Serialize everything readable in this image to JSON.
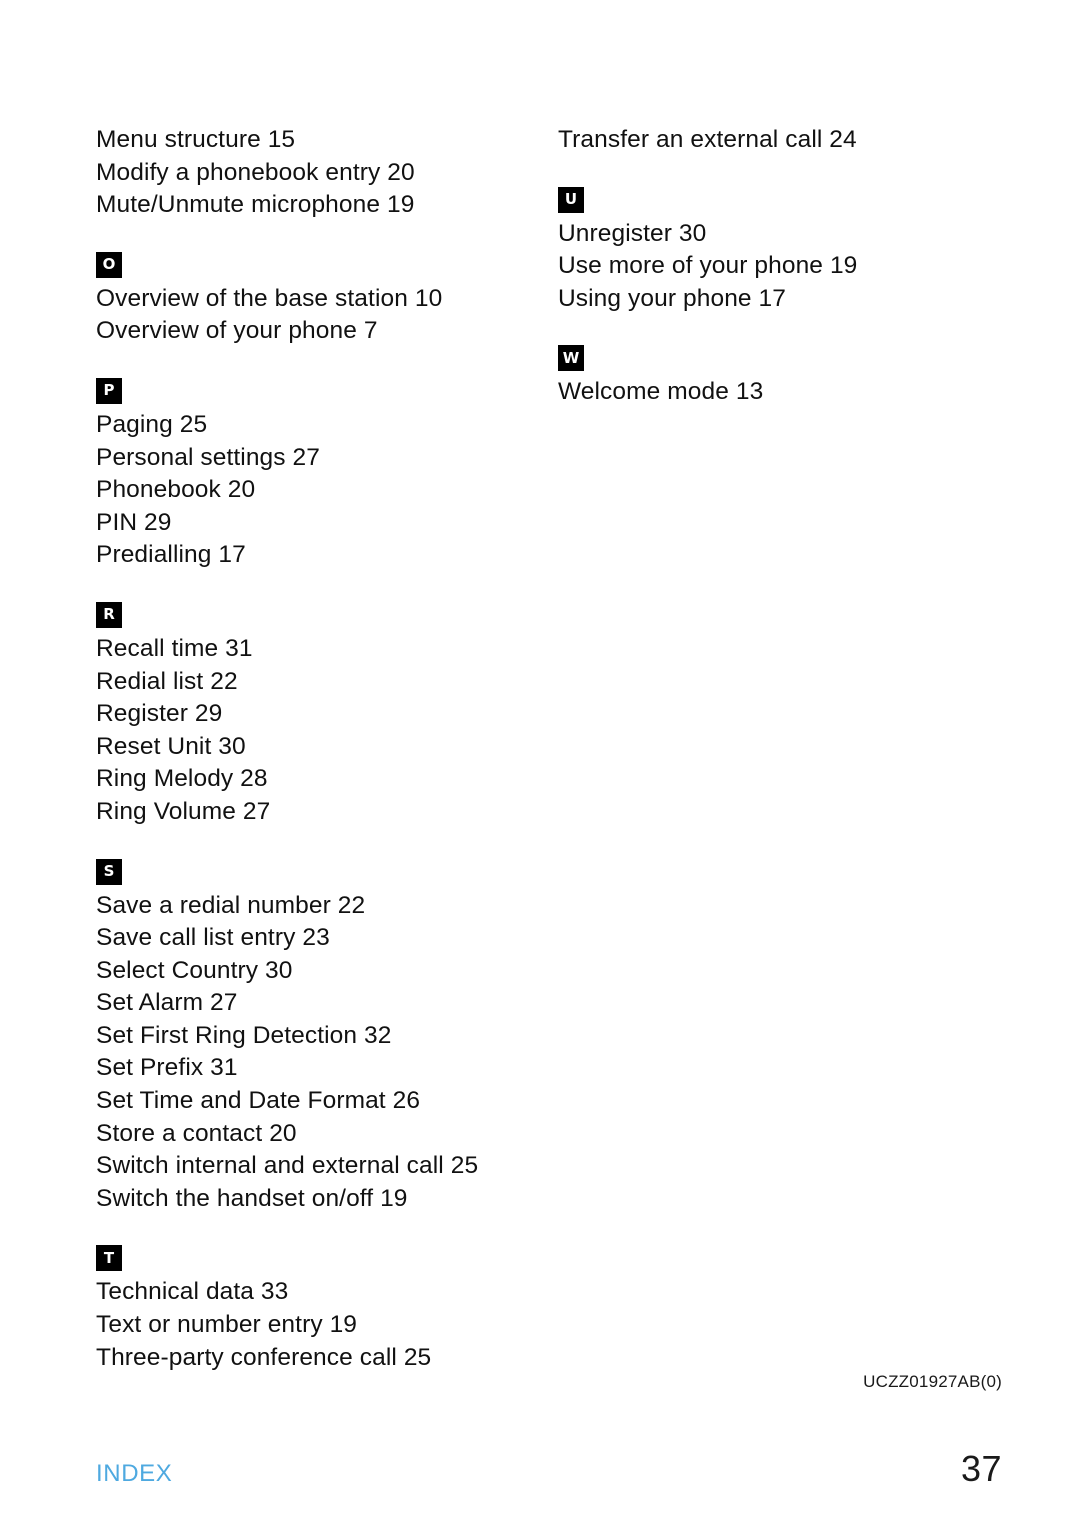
{
  "document": {
    "code": "UCZZ01927AB(0)",
    "footer_label": "INDEX",
    "page_number": "37",
    "accent_color": "#4ea9e0",
    "badge_background": "#000000",
    "badge_text_color": "#ffffff"
  },
  "columns": {
    "left": [
      {
        "letter": "",
        "has_badge": false,
        "entries": [
          "Menu structure 15",
          "Modify a phonebook entry 20",
          "Mute/Unmute microphone 19"
        ]
      },
      {
        "letter": "O",
        "has_badge": true,
        "entries": [
          "Overview of the base station 10",
          "Overview of your phone 7"
        ]
      },
      {
        "letter": "P",
        "has_badge": true,
        "entries": [
          "Paging 25",
          "Personal settings 27",
          "Phonebook 20",
          "PIN 29",
          "Predialling 17"
        ]
      },
      {
        "letter": "R",
        "has_badge": true,
        "entries": [
          "Recall time 31",
          "Redial list 22",
          "Register 29",
          "Reset Unit 30",
          "Ring Melody 28",
          "Ring Volume 27"
        ]
      },
      {
        "letter": "S",
        "has_badge": true,
        "entries": [
          "Save a redial number 22",
          "Save call list entry 23",
          "Select Country 30",
          "Set Alarm 27",
          "Set First Ring Detection 32",
          "Set Prefix 31",
          "Set Time and Date Format 26",
          "Store a contact 20",
          "Switch internal and external call 25",
          "Switch the handset on/off 19"
        ]
      },
      {
        "letter": "T",
        "has_badge": true,
        "entries": [
          "Technical data 33",
          "Text or number entry 19",
          "Three-party conference call 25"
        ]
      }
    ],
    "right": [
      {
        "letter": "",
        "has_badge": false,
        "entries": [
          "Transfer an external call 24"
        ]
      },
      {
        "letter": "U",
        "has_badge": true,
        "entries": [
          "Unregister 30",
          "Use more of your phone 19",
          "Using your phone 17"
        ]
      },
      {
        "letter": "W",
        "has_badge": true,
        "entries": [
          "Welcome mode 13"
        ]
      }
    ]
  }
}
